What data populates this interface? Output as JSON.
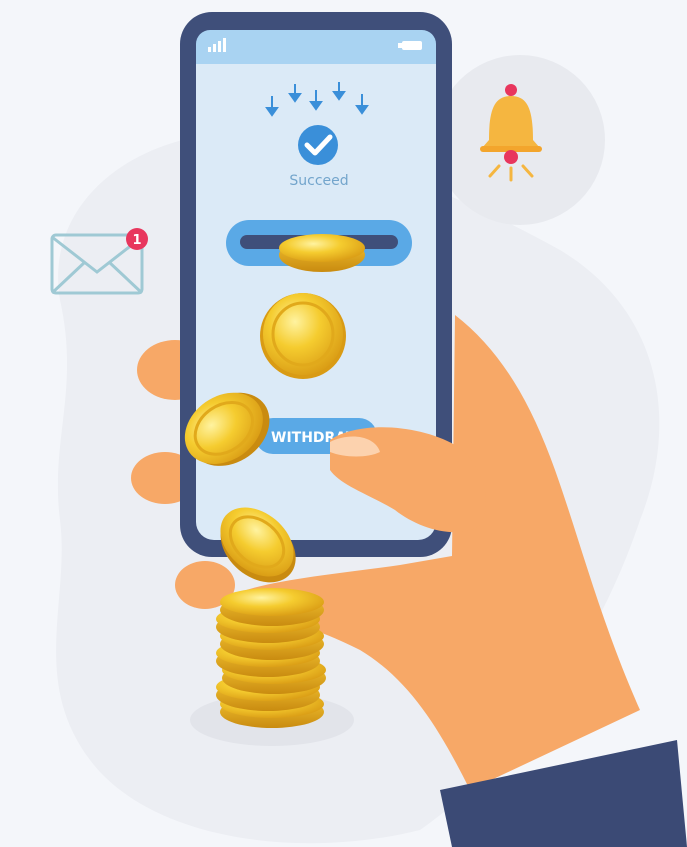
{
  "status": {
    "label": "Succeed",
    "icon": "checkmark-icon",
    "color": "#3a8fd9"
  },
  "action": {
    "withdraw_label": "WITHDRAW",
    "color": "#5aa9e6"
  },
  "notifications": {
    "mail_badge_count": "1",
    "badge_color": "#e8365d"
  },
  "colors": {
    "phone_frame": "#3f4f7a",
    "screen": "#dbeaf7",
    "coin": "#f2c12e",
    "skin": "#f7a867",
    "sleeve": "#3b4a75",
    "bell": "#f5b640"
  }
}
